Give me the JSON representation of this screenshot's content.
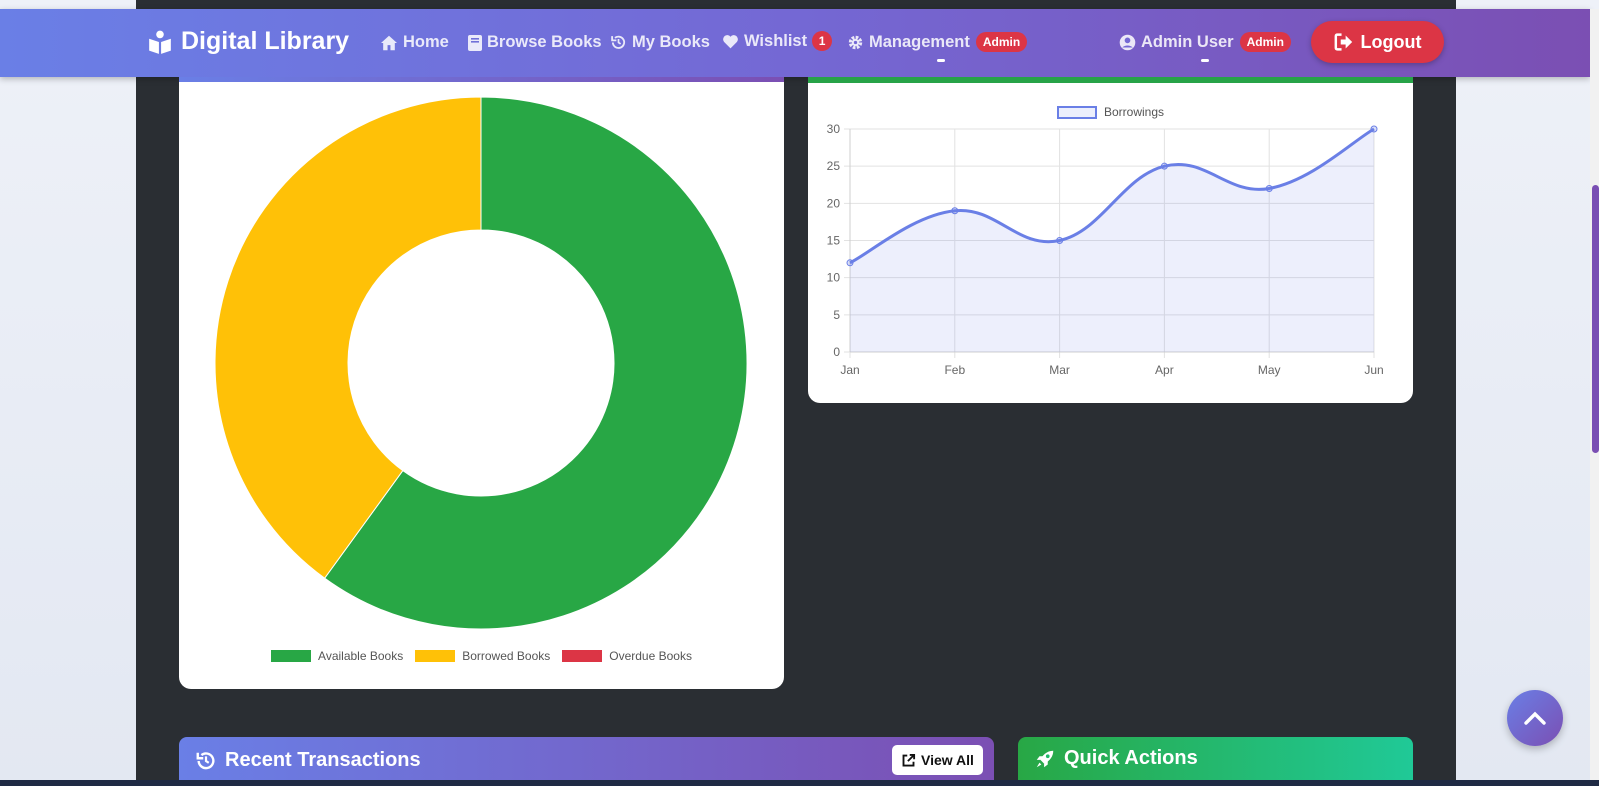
{
  "navbar": {
    "brand": "Digital Library",
    "links": {
      "home": "Home",
      "browse": "Browse Books",
      "my_books": "My Books",
      "wishlist": "Wishlist",
      "wishlist_count": "1",
      "management": "Management",
      "management_badge": "Admin"
    },
    "user": {
      "name": "Admin User",
      "role_badge": "Admin"
    },
    "logout_label": "Logout"
  },
  "chart_data": [
    {
      "type": "pie",
      "variant": "doughnut",
      "legend_position": "bottom",
      "categories": [
        "Available Books",
        "Borrowed Books",
        "Overdue Books"
      ],
      "values": [
        60,
        40,
        0
      ],
      "colors": [
        "#28a745",
        "#ffc107",
        "#dc3545"
      ]
    },
    {
      "type": "area",
      "legend_position": "top",
      "grid": true,
      "x": [
        "Jan",
        "Feb",
        "Mar",
        "Apr",
        "May",
        "Jun"
      ],
      "series": [
        {
          "name": "Borrowings",
          "values": [
            12,
            19,
            15,
            25,
            22,
            30
          ],
          "color": "#6a7fe6"
        }
      ],
      "ylim": [
        0,
        30
      ],
      "yticks": [
        "0",
        "5",
        "10",
        "15",
        "20",
        "25",
        "30"
      ]
    }
  ],
  "bottom": {
    "transactions_title": "Recent Transactions",
    "view_all_label": "View All",
    "quick_actions_title": "Quick Actions"
  }
}
